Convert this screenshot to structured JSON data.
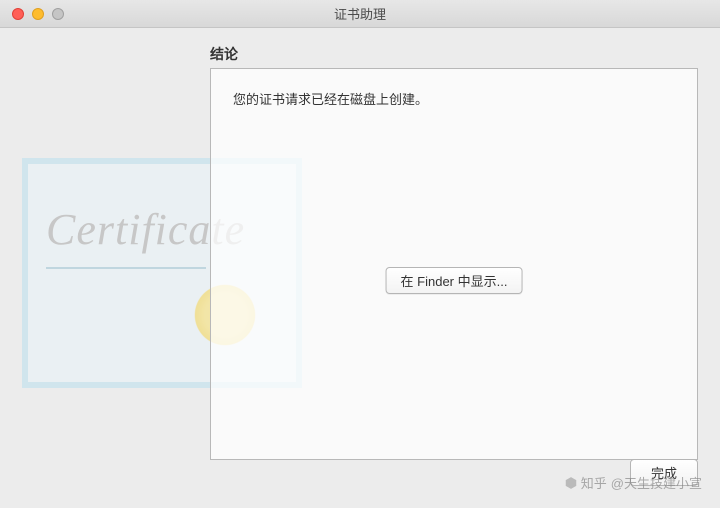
{
  "window": {
    "title": "证书助理"
  },
  "panel": {
    "heading": "结论",
    "message": "您的证书请求已经在磁盘上创建。",
    "show_in_finder_label": "在 Finder 中显示...",
    "done_label": "完成"
  },
  "decor": {
    "certificate_word": "Certificate"
  },
  "watermark": {
    "brand": "知乎",
    "author": "@天生技建小宣"
  }
}
